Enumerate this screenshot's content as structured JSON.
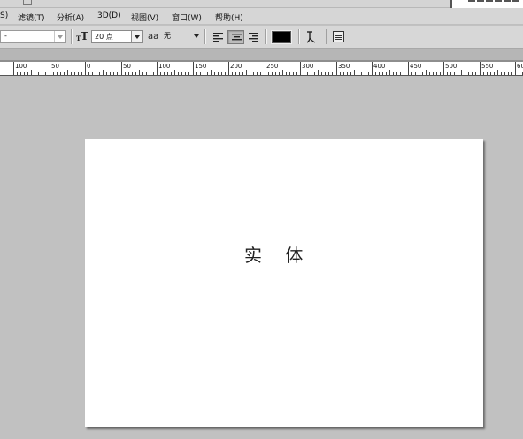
{
  "menubar": {
    "items": [
      {
        "label": "S)"
      },
      {
        "label": "滤镜(T)"
      },
      {
        "label": "分析(A)"
      },
      {
        "label": "3D(D)"
      },
      {
        "label": "视图(V)"
      },
      {
        "label": "窗口(W)"
      },
      {
        "label": "帮助(H)"
      }
    ]
  },
  "options_bar": {
    "font_style_value": "-",
    "font_size_value": "20 点",
    "antialias_icon": "aa",
    "antialias_value": "无",
    "text_color": "#000000",
    "align_active": "center"
  },
  "ruler": {
    "labels": [
      "100",
      "50",
      "0",
      "50",
      "100",
      "150",
      "200",
      "250",
      "300",
      "350",
      "400",
      "450",
      "500",
      "550",
      "600"
    ]
  },
  "document": {
    "text": "实 体",
    "background": "#ffffff"
  }
}
